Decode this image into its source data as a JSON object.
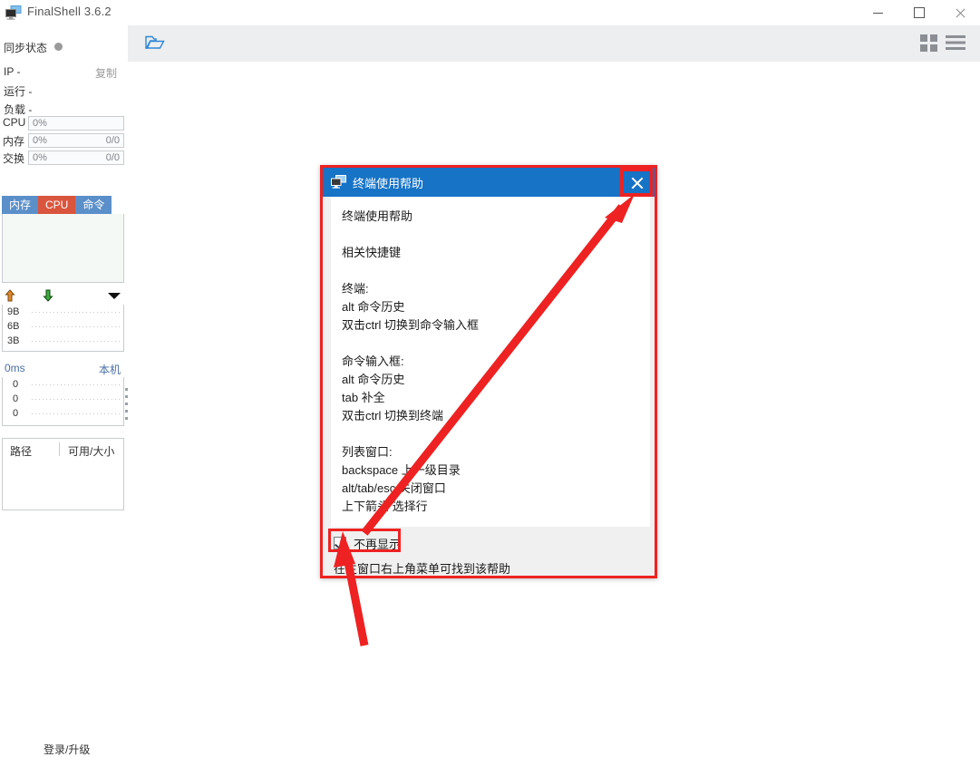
{
  "window": {
    "title": "FinalShell 3.6.2",
    "app_icon": "monitor-icon",
    "minimize_label": "—",
    "maximize_label": "□",
    "close_label": "✕"
  },
  "toolbar": {
    "open_folder_icon": "open-folder-icon",
    "grid_view_icon": "grid-view-icon",
    "list_view_icon": "list-view-icon"
  },
  "sidebar": {
    "sync_status_label": "同步状态",
    "ip_label": "IP  -",
    "copy_label": "复制",
    "run_label": "运行 -",
    "load_label": "负载 -",
    "meters": [
      {
        "name": "CPU",
        "value": "0%",
        "right": ""
      },
      {
        "name": "内存",
        "value": "0%",
        "right": "0/0"
      },
      {
        "name": "交换",
        "value": "0%",
        "right": "0/0"
      }
    ],
    "process_tabs": [
      {
        "label": "内存",
        "active": false
      },
      {
        "label": "CPU",
        "active": true
      },
      {
        "label": "命令",
        "active": false
      }
    ],
    "network": {
      "upload_icon": "arrow-up-icon",
      "download_icon": "arrow-down-icon",
      "caret_icon": "chevron-down-icon",
      "y_labels": [
        "9B",
        "6B",
        "3B"
      ]
    },
    "ping": {
      "latency": "0ms",
      "host": "本机",
      "y_labels": [
        "0",
        "0",
        "0"
      ]
    },
    "disk": {
      "col_path": "路径",
      "col_free_total": "可用/大小"
    },
    "login_upgrade": "登录/升级"
  },
  "dialog": {
    "title": "终端使用帮助",
    "title_icon": "monitor-icon",
    "close_label": "✕",
    "body_text": "终端使用帮助\n\n相关快捷键\n\n终端:\nalt 命令历史\n双击ctrl 切换到命令输入框\n\n命令输入框:\nalt 命令历史\ntab 补全\n双击ctrl 切换到终端\n\n列表窗口:\nbackspace 上一级目录\nalt/tab/esc 关闭窗口\n上下箭头 选择行",
    "checkbox_label": "不再显示",
    "checkbox_checked": true,
    "footer_note": "在主窗口右上角菜单可找到该帮助"
  },
  "annotations": {
    "highlight_color": "#ee2222",
    "arrow_to_close_button": "arrow-pointing-to-close-button",
    "arrow_to_checkbox": "arrow-pointing-to-checkbox"
  }
}
